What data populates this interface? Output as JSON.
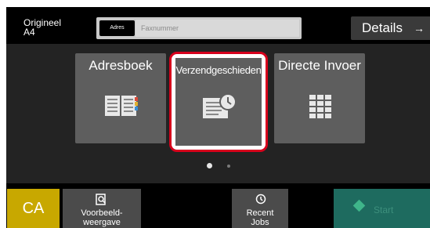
{
  "original": {
    "label": "Origineel",
    "size": "A4"
  },
  "address": {
    "button_label": "Adres",
    "placeholder": "Faxnummer"
  },
  "details": {
    "label": "Details",
    "arrow": "→"
  },
  "tiles": [
    {
      "label": "Adresboek",
      "icon": "address-book-icon"
    },
    {
      "label": "Verzendgeschieden",
      "icon": "send-history-icon"
    },
    {
      "label": "Directe Invoer",
      "icon": "keypad-icon"
    }
  ],
  "selected_tile": "Verzendgeschieden",
  "pagination": {
    "current": 1,
    "total": 2
  },
  "bottom": {
    "ca_label": "CA",
    "preview_label_line1": "Voorbeeld-",
    "preview_label_line2": "weergave",
    "recent_label_line1": "Recent",
    "recent_label_line2": "Jobs",
    "start_label": "Start"
  },
  "colors": {
    "ca": "#c8a800",
    "start": "#1e6b5f",
    "highlight": "#d6001c",
    "tile": "#5e5e5e"
  }
}
